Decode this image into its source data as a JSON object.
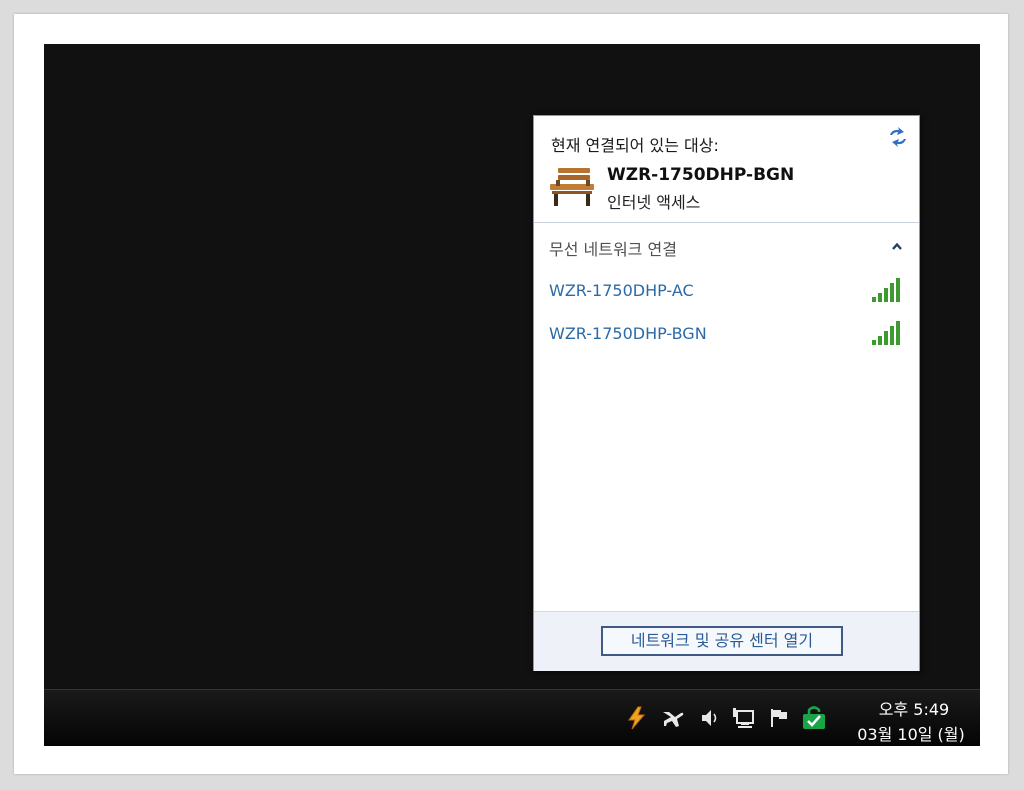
{
  "flyout": {
    "current_header": "현재 연결되어 있는 대상:",
    "current_connection": {
      "name": "WZR-1750DHP-BGN",
      "status": "인터넷 액세스"
    },
    "wireless_section": {
      "title": "무선 네트워크 연결",
      "networks": [
        {
          "ssid": "WZR-1750DHP-AC",
          "signal_bars": 5
        },
        {
          "ssid": "WZR-1750DHP-BGN",
          "signal_bars": 5
        }
      ]
    },
    "footer": {
      "open_center_label": "네트워크 및 공유 센터 열기"
    }
  },
  "taskbar": {
    "tray_icons": [
      "lightning-icon",
      "airplane-icon",
      "speaker-icon",
      "network-icon",
      "action-center-flag-icon",
      "security-shield-icon"
    ],
    "clock": {
      "time": "오후 5:49",
      "date": "03월 10일 (월)"
    }
  },
  "colors": {
    "link_blue": "#2b6aa8",
    "signal_green": "#3d9a2f",
    "desktop_black": "#111111"
  }
}
